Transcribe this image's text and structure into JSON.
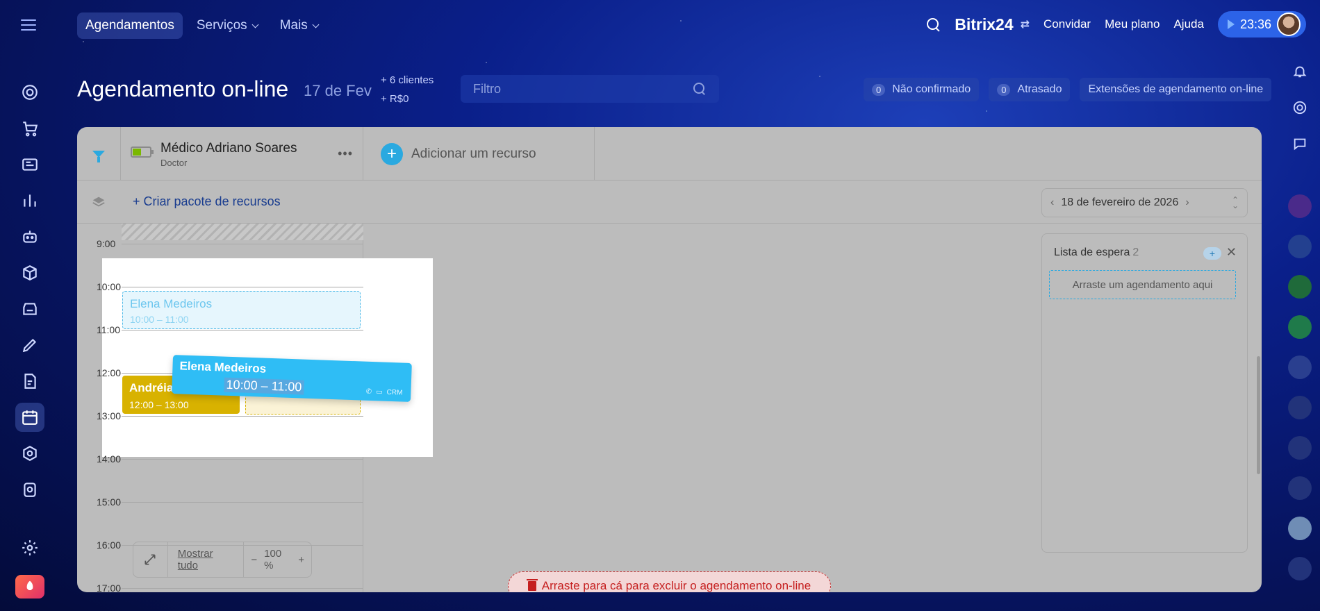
{
  "topnav": {
    "items": [
      {
        "label": "Agendamentos",
        "active": true
      },
      {
        "label": "Serviços",
        "active": false
      },
      {
        "label": "Mais",
        "active": false
      }
    ]
  },
  "header": {
    "brand": "Bitrix24",
    "invite": "Convidar",
    "plan": "Meu plano",
    "help": "Ajuda",
    "time": "23:36"
  },
  "page": {
    "title": "Agendamento on-line",
    "date": "17 de Fev",
    "stat_clients": "+ 6 clientes",
    "stat_revenue": "+ R$0",
    "filter_placeholder": "Filtro",
    "unconfirmed_count": "0",
    "unconfirmed_label": "Não confirmado",
    "late_count": "0",
    "late_label": "Atrasado",
    "extensions_label": "Extensões de agendamento on-line"
  },
  "resource": {
    "name": "Médico Adriano Soares",
    "type": "Doctor",
    "add_label": "Adicionar um recurso",
    "create_pack": "+ Criar pacote de recursos"
  },
  "date_nav": {
    "label": "18 de fevereiro de 2026"
  },
  "times": [
    "9:00",
    "10:00",
    "11:00",
    "12:00",
    "13:00",
    "14:00",
    "15:00",
    "16:00",
    "17:00"
  ],
  "events": {
    "ghost": {
      "name": "Elena Medeiros",
      "time": "10:00 – 11:00"
    },
    "gold": {
      "name": "Andréia",
      "time": "12:00 – 13:00"
    },
    "drag": {
      "name": "Elena Medeiros",
      "time": "10:00 – 11:00",
      "crm": "CRM"
    }
  },
  "toolbar": {
    "show_all": "Mostrar tudo",
    "zoom": "100 %",
    "minus": "−",
    "plus": "+"
  },
  "trash": {
    "label": "Arraste para cá para excluir o agendamento on-line"
  },
  "waitlist": {
    "title": "Lista de espera",
    "count": "2",
    "plus": "+",
    "drop": "Arraste um agendamento aqui"
  },
  "colors": {
    "accent": "#2aa9e0",
    "gold": "#d8b200",
    "danger": "#c51e1e",
    "brand_bg": "#0a1f8a"
  },
  "icons": [
    "menu-icon",
    "search-icon",
    "sliders-icon",
    "play-icon",
    "bell-icon",
    "filter-icon",
    "layers-icon",
    "trash-icon",
    "expand-icon",
    "phone-icon",
    "chat-icon",
    "close-icon"
  ]
}
